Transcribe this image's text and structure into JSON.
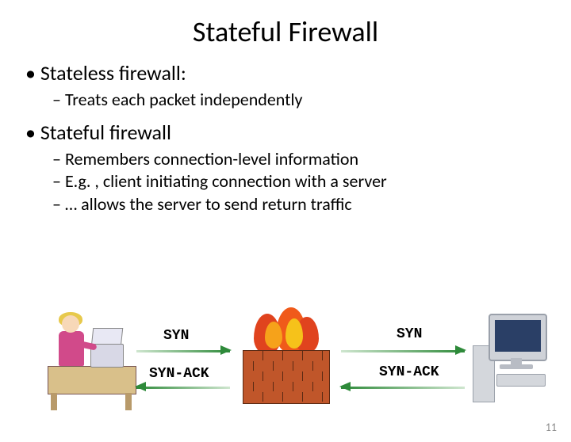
{
  "title": "Stateful Firewall",
  "bullets": {
    "stateless": {
      "heading": "Stateless firewall:",
      "items": [
        "Treats each packet independently"
      ]
    },
    "stateful": {
      "heading": "Stateful firewall",
      "items": [
        "Remembers connection-level information",
        "E.g. , client initiating connection with a server",
        "… allows the server to send return traffic"
      ]
    }
  },
  "diagram": {
    "left_top_label": "SYN",
    "left_bottom_label": "SYN-ACK",
    "right_top_label": "SYN",
    "right_bottom_label": "SYN-ACK"
  },
  "page_number": "11"
}
